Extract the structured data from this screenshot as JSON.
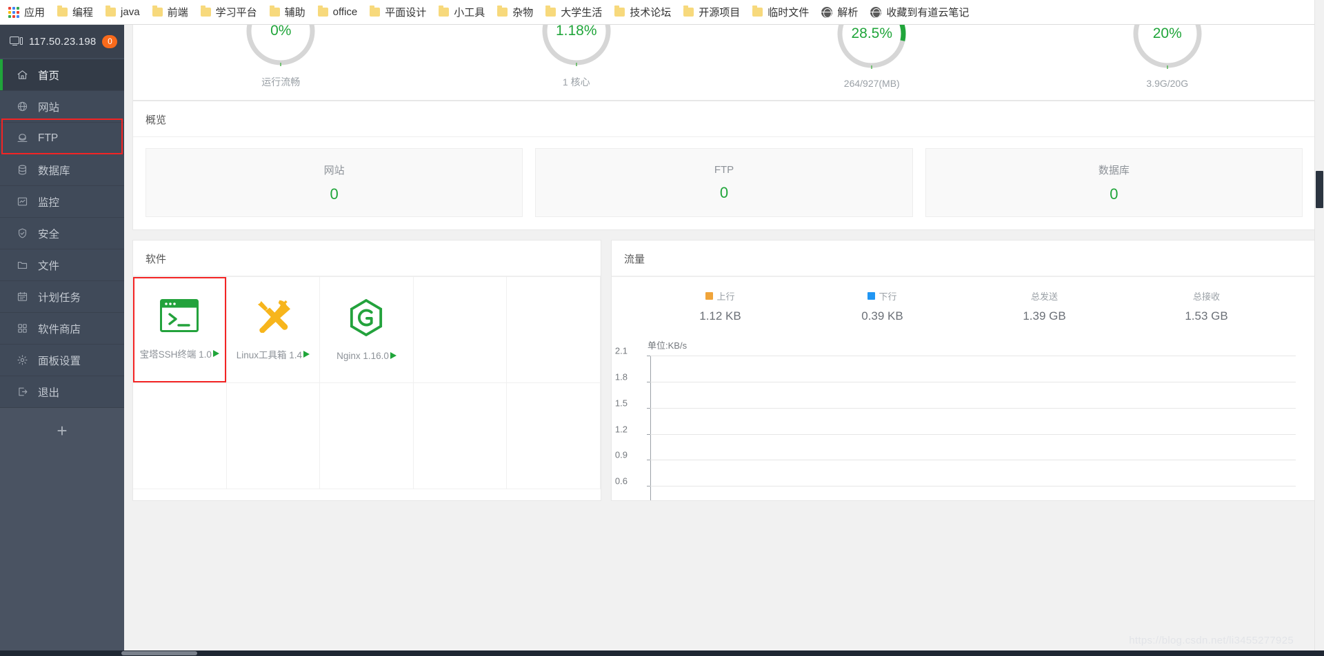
{
  "browser": {
    "bookmarks": [
      {
        "label": "应用",
        "icon": "apps-grid-icon"
      },
      {
        "label": "编程",
        "icon": "folder-icon"
      },
      {
        "label": "java",
        "icon": "folder-icon"
      },
      {
        "label": "前端",
        "icon": "folder-icon"
      },
      {
        "label": "学习平台",
        "icon": "folder-icon"
      },
      {
        "label": "辅助",
        "icon": "folder-icon"
      },
      {
        "label": "office",
        "icon": "folder-icon"
      },
      {
        "label": "平面设计",
        "icon": "folder-icon"
      },
      {
        "label": "小工具",
        "icon": "folder-icon"
      },
      {
        "label": "杂物",
        "icon": "folder-icon"
      },
      {
        "label": "大学生活",
        "icon": "folder-icon"
      },
      {
        "label": "技术论坛",
        "icon": "folder-icon"
      },
      {
        "label": "开源项目",
        "icon": "folder-icon"
      },
      {
        "label": "临时文件",
        "icon": "folder-icon"
      },
      {
        "label": "解析",
        "icon": "globe-icon"
      },
      {
        "label": "收藏到有道云笔记",
        "icon": "globe-icon"
      }
    ]
  },
  "sidebar": {
    "server_ip": "117.50.23.198",
    "notification_count": "0",
    "add_button_label": "+",
    "items": [
      {
        "label": "首页",
        "icon": "home-icon",
        "active": true
      },
      {
        "label": "网站",
        "icon": "globe-icon",
        "active": false
      },
      {
        "label": "FTP",
        "icon": "ftp-icon",
        "active": false
      },
      {
        "label": "数据库",
        "icon": "database-icon",
        "active": false
      },
      {
        "label": "监控",
        "icon": "monitor-chart-icon",
        "active": false
      },
      {
        "label": "安全",
        "icon": "shield-check-icon",
        "active": false
      },
      {
        "label": "文件",
        "icon": "folder-icon",
        "active": false
      },
      {
        "label": "计划任务",
        "icon": "calendar-icon",
        "active": false
      },
      {
        "label": "软件商店",
        "icon": "grid-squares-icon",
        "active": false
      },
      {
        "label": "面板设置",
        "icon": "gear-icon",
        "active": false
      },
      {
        "label": "退出",
        "icon": "logout-icon",
        "active": false
      }
    ]
  },
  "gauges": [
    {
      "value": "0%",
      "label": "运行流畅",
      "percent": 0,
      "rocket": false
    },
    {
      "value": "1.18%",
      "label": "1 核心",
      "percent": 1.18,
      "rocket": false
    },
    {
      "value": "28.5%",
      "label": "264/927(MB)",
      "percent": 28.5,
      "rocket": true
    },
    {
      "value": "20%",
      "label": "3.9G/20G",
      "percent": 20,
      "rocket": false
    }
  ],
  "overview": {
    "title": "概览",
    "boxes": [
      {
        "label": "网站",
        "value": "0"
      },
      {
        "label": "FTP",
        "value": "0"
      },
      {
        "label": "数据库",
        "value": "0"
      }
    ]
  },
  "software": {
    "title": "软件",
    "items": [
      {
        "name": "宝塔SSH终端 1.0",
        "icon": "terminal-icon",
        "highlighted": true
      },
      {
        "name": "Linux工具箱 1.4",
        "icon": "tools-icon",
        "highlighted": false
      },
      {
        "name": "Nginx 1.16.0",
        "icon": "nginx-g-icon",
        "highlighted": false
      }
    ]
  },
  "traffic": {
    "title": "流量",
    "stats": [
      {
        "label": "上行",
        "value": "1.12 KB",
        "color": "#f0a43a",
        "swatch": true
      },
      {
        "label": "下行",
        "value": "0.39 KB",
        "color": "#2196f3",
        "swatch": true
      },
      {
        "label": "总发送",
        "value": "1.39 GB",
        "color": "",
        "swatch": false
      },
      {
        "label": "总接收",
        "value": "1.53 GB",
        "color": "",
        "swatch": false
      }
    ]
  },
  "chart_data": {
    "type": "line",
    "title": "流量",
    "unit_label": "单位:KB/s",
    "ylabel": "KB/s",
    "yticks": [
      "2.1",
      "1.8",
      "1.5",
      "1.2",
      "0.9",
      "0.6"
    ],
    "ylim": [
      0.6,
      2.1
    ],
    "grid": true,
    "series": [
      {
        "name": "上行",
        "color": "#f0a43a",
        "values": []
      },
      {
        "name": "下行",
        "color": "#2196f3",
        "values": []
      }
    ],
    "x": [],
    "xlabel": ""
  },
  "watermark": "https://blog.csdn.net/li3455277925",
  "colors": {
    "accent_green": "#20a53a",
    "sidebar_bg": "#404a59",
    "highlight_red": "#f42424",
    "badge_orange": "#f96a1b"
  }
}
